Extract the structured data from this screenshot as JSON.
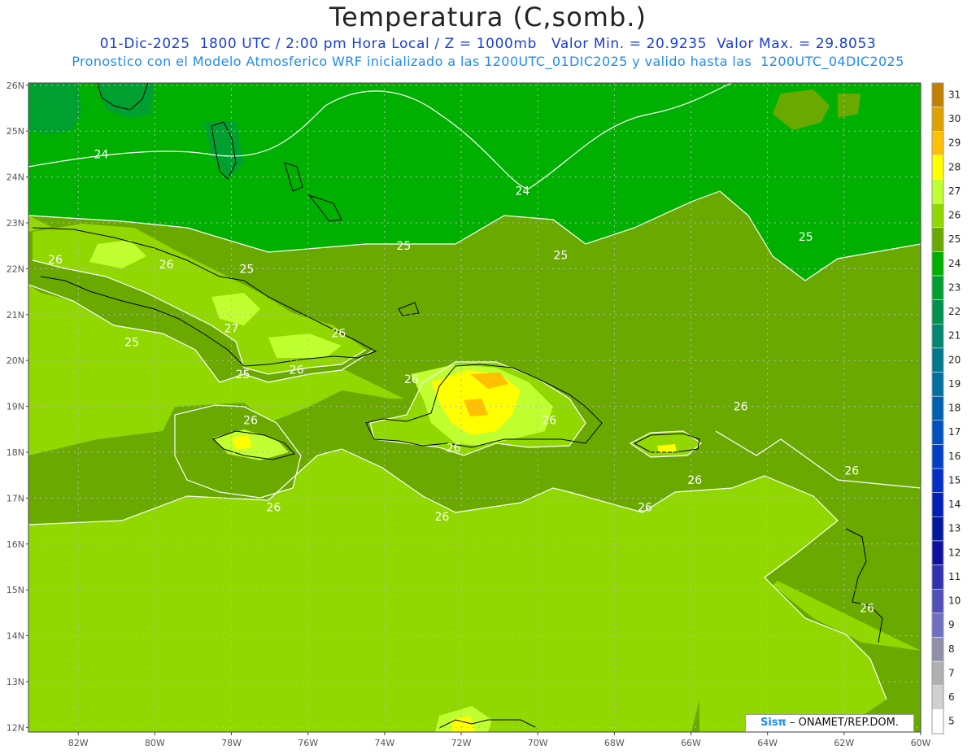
{
  "header": {
    "title": "Temperatura (C,somb.)",
    "line1": "01-Dic-2025  1800 UTC / 2:00 pm Hora Local / Z = 1000mb   Valor Min. = 20.9235  Valor Max. = 29.8053",
    "line2": "Pronostico con el Modelo Atmosferico WRF inicializado a las 1200UTC_01DIC2025 y valido hasta las  1200UTC_04DIC2025"
  },
  "axes": {
    "lat_labels": [
      "26N",
      "25N",
      "24N",
      "23N",
      "22N",
      "21N",
      "20N",
      "19N",
      "18N",
      "17N",
      "16N",
      "15N",
      "14N",
      "13N",
      "12N"
    ],
    "lat_values": [
      26,
      25,
      24,
      23,
      22,
      21,
      20,
      19,
      18,
      17,
      16,
      15,
      14,
      13,
      12
    ],
    "lon_labels": [
      "82W",
      "80W",
      "78W",
      "76W",
      "74W",
      "72W",
      "70W",
      "68W",
      "66W",
      "64W",
      "62W",
      "60W"
    ],
    "lon_values": [
      -82,
      -80,
      -78,
      -76,
      -74,
      -72,
      -70,
      -68,
      -66,
      -64,
      -62,
      -60
    ],
    "lon_range": [
      -83.3,
      -60
    ],
    "lat_range": [
      11.9,
      26.05
    ]
  },
  "colorbar": {
    "levels": [
      "31",
      "30",
      "29",
      "28",
      "27",
      "26",
      "25",
      "24",
      "23",
      "22",
      "21",
      "20",
      "19",
      "18",
      "17",
      "16",
      "15",
      "14",
      "13",
      "12",
      "11",
      "10",
      "9",
      "8",
      "7",
      "6",
      "5"
    ],
    "colors": [
      "#c08000",
      "#e0a000",
      "#ffc000",
      "#ffff00",
      "#c0ff30",
      "#90d800",
      "#6aaa00",
      "#00b000",
      "#00a030",
      "#009050",
      "#008870",
      "#007890",
      "#0070a0",
      "#0060b0",
      "#0050c0",
      "#0040c8",
      "#0030c8",
      "#0020b8",
      "#0018a0",
      "#1010a0",
      "#3030b0",
      "#5050b8",
      "#7070c0",
      "#9090a8",
      "#b0b0b0",
      "#d0d0d0",
      "#ffffff"
    ]
  },
  "palette": {
    "t23": "#00a030",
    "t24": "#00b000",
    "t25": "#6aaa00",
    "t26": "#90d800",
    "t27": "#c0ff30",
    "t28": "#ffff00",
    "t29": "#ffc000",
    "t30": "#e0a000"
  },
  "contour_labels": [
    {
      "text": "24",
      "lon": -81.4,
      "lat": 24.5
    },
    {
      "text": "24",
      "lon": -70.4,
      "lat": 23.7
    },
    {
      "text": "25",
      "lon": -73.5,
      "lat": 22.5
    },
    {
      "text": "25",
      "lon": -69.4,
      "lat": 22.3
    },
    {
      "text": "25",
      "lon": -63.0,
      "lat": 22.7
    },
    {
      "text": "25",
      "lon": -77.6,
      "lat": 22.0
    },
    {
      "text": "25",
      "lon": -80.6,
      "lat": 20.4
    },
    {
      "text": "25",
      "lon": -77.7,
      "lat": 19.7
    },
    {
      "text": "26",
      "lon": -82.6,
      "lat": 22.2
    },
    {
      "text": "26",
      "lon": -79.7,
      "lat": 22.1
    },
    {
      "text": "27",
      "lon": -78.0,
      "lat": 20.7
    },
    {
      "text": "26",
      "lon": -75.2,
      "lat": 20.6
    },
    {
      "text": "26",
      "lon": -76.3,
      "lat": 19.8
    },
    {
      "text": "26",
      "lon": -73.3,
      "lat": 19.6
    },
    {
      "text": "26",
      "lon": -69.7,
      "lat": 18.7
    },
    {
      "text": "26",
      "lon": -72.2,
      "lat": 18.1
    },
    {
      "text": "26",
      "lon": -77.5,
      "lat": 18.7
    },
    {
      "text": "26",
      "lon": -76.9,
      "lat": 16.8
    },
    {
      "text": "26",
      "lon": -72.5,
      "lat": 16.6
    },
    {
      "text": "26",
      "lon": -64.7,
      "lat": 19.0
    },
    {
      "text": "26",
      "lon": -67.2,
      "lat": 16.8
    },
    {
      "text": "26",
      "lon": -65.9,
      "lat": 17.4
    },
    {
      "text": "26",
      "lon": -61.8,
      "lat": 17.6
    },
    {
      "text": "26",
      "lon": -61.4,
      "lat": 14.6
    }
  ],
  "credit": {
    "brand": "Sisπ",
    "text": " – ONAMET/REP.DOM."
  }
}
